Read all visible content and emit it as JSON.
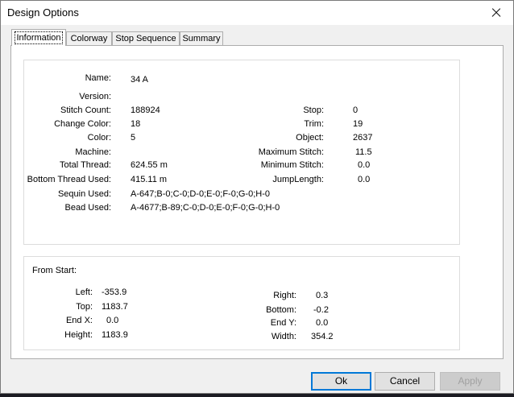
{
  "window": {
    "title": "Design Options"
  },
  "tabs": [
    "Information",
    "Colorway",
    "Stop Sequence",
    "Summary"
  ],
  "info": {
    "name_label": "Name:",
    "name": "34 A",
    "version_label": "Version:",
    "version": "",
    "stitch_count_label": "Stitch Count:",
    "stitch_count": "188924",
    "change_color_label": "Change Color:",
    "change_color": "18",
    "color_label": "Color:",
    "color": "5",
    "machine_label": "Machine:",
    "machine": "",
    "total_thread_label": "Total Thread:",
    "total_thread": "624.55 m",
    "bottom_thread_label": "Bottom Thread Used:",
    "bottom_thread": "415.11 m",
    "sequin_label": "Sequin Used:",
    "sequin": "A-647;B-0;C-0;D-0;E-0;F-0;G-0;H-0",
    "bead_label": "Bead Used:",
    "bead": "A-4677;B-89;C-0;D-0;E-0;F-0;G-0;H-0",
    "stop_label": "Stop:",
    "stop": "0",
    "trim_label": "Trim:",
    "trim": "19",
    "object_label": "Object:",
    "object": "2637",
    "max_stitch_label": "Maximum Stitch:",
    "max_stitch": "11.5",
    "min_stitch_label": "Minimum Stitch:",
    "min_stitch": "0.0",
    "jump_length_label": "JumpLength:",
    "jump_length": "0.0"
  },
  "from_start": {
    "header": "From Start:",
    "left_label": "Left:",
    "left": "-353.9",
    "top_label": "Top:",
    "top": "1183.7",
    "endx_label": "End X:",
    "endx": "0.0",
    "height_label": "Height:",
    "height": "1183.9",
    "right_label": "Right:",
    "right": "0.3",
    "bottom_label": "Bottom:",
    "bottom": "-0.2",
    "endy_label": "End Y:",
    "endy": "0.0",
    "width_label": "Width:",
    "width": "354.2"
  },
  "buttons": {
    "ok": "Ok",
    "cancel": "Cancel",
    "apply": "Apply"
  }
}
